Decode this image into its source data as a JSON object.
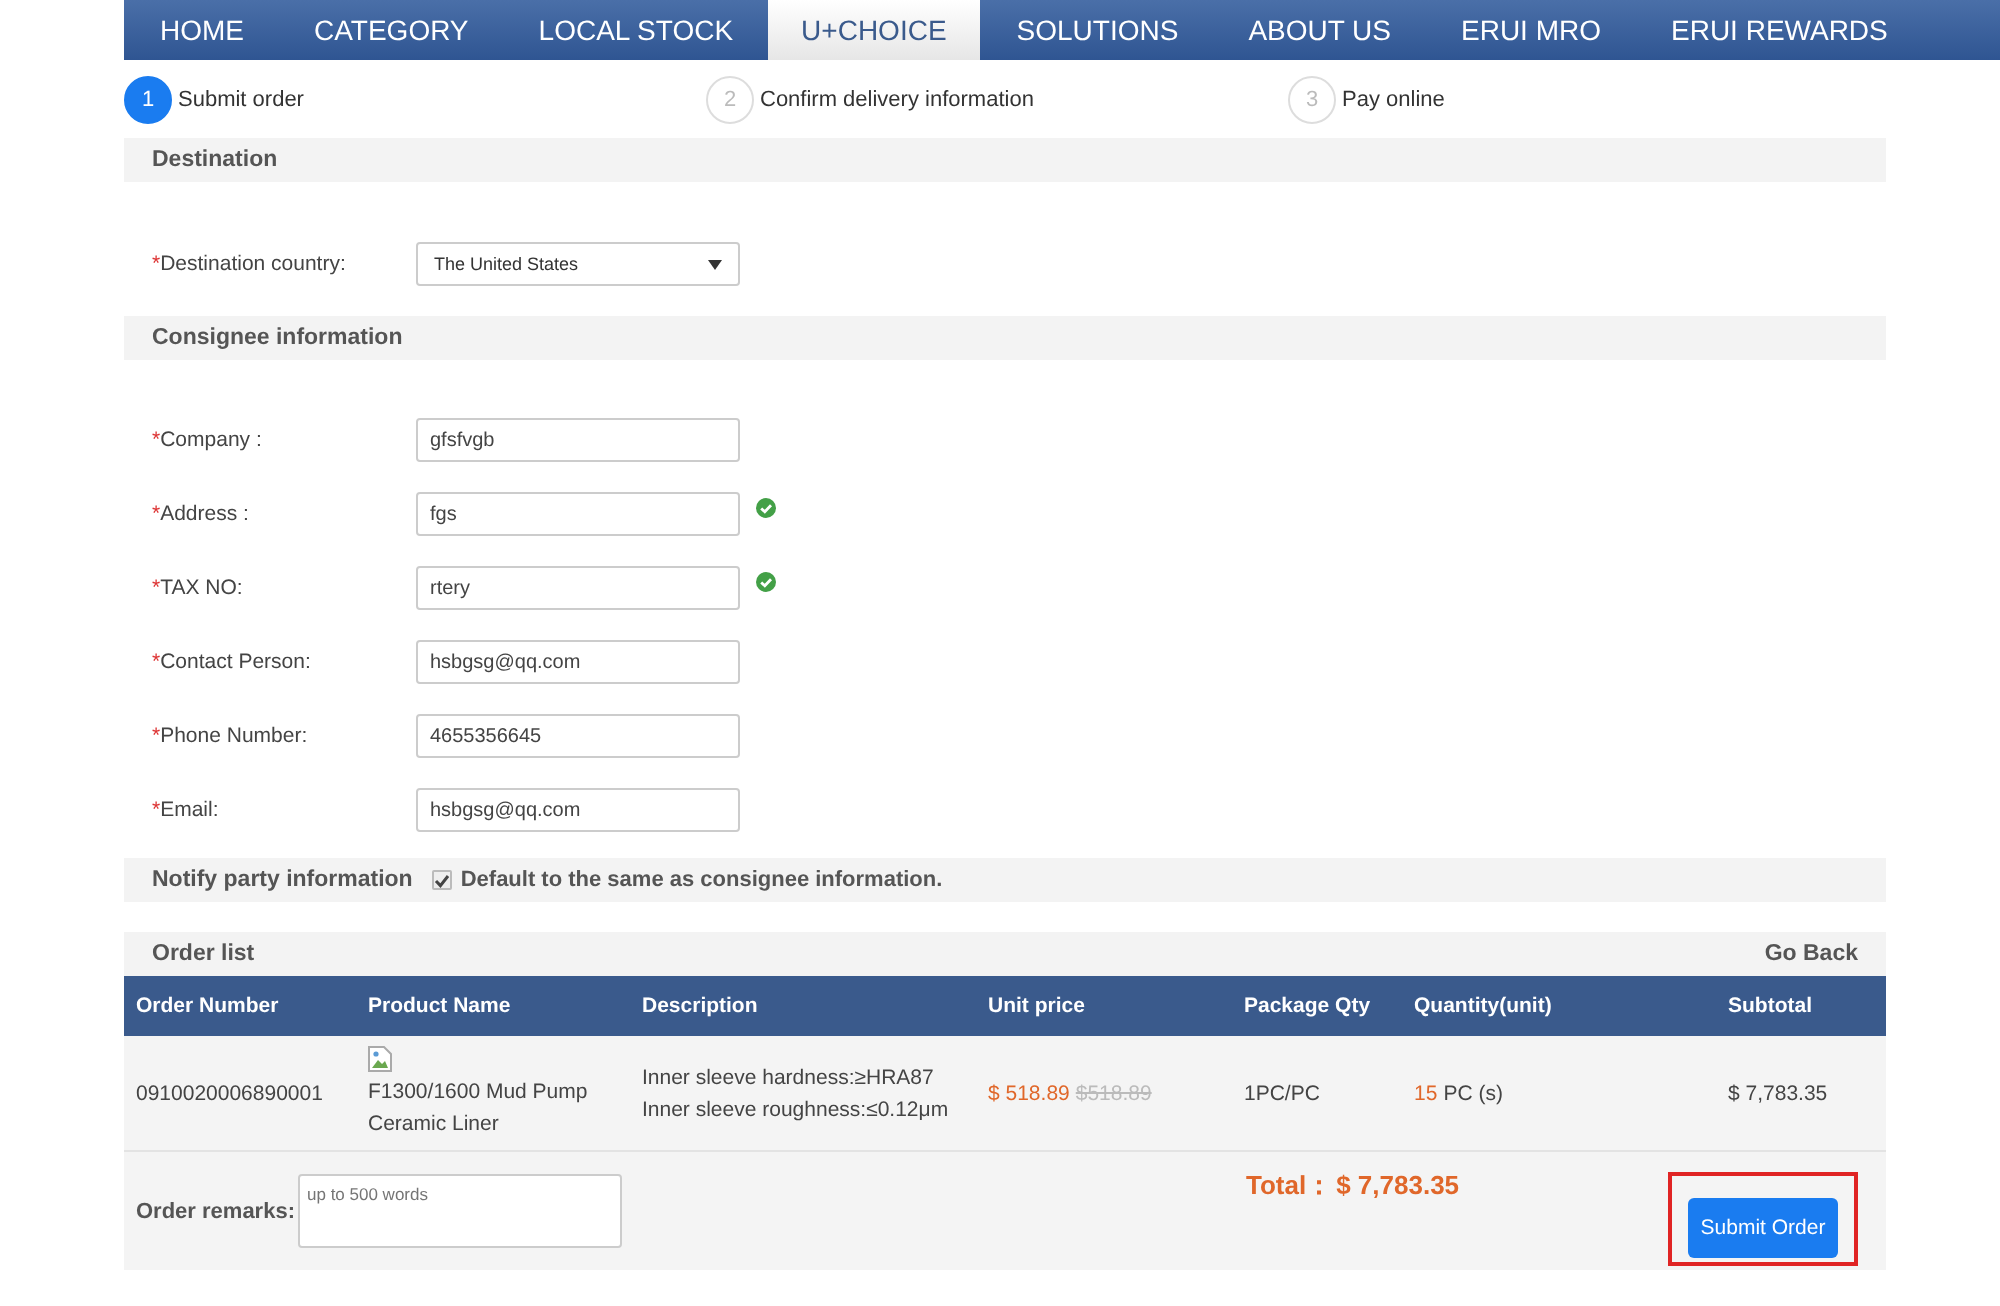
{
  "nav": [
    {
      "label": "HOME",
      "selected": false
    },
    {
      "label": "CATEGORY",
      "selected": false
    },
    {
      "label": "LOCAL STOCK",
      "selected": false
    },
    {
      "label": "U+CHOICE",
      "selected": true
    },
    {
      "label": "SOLUTIONS",
      "selected": false
    },
    {
      "label": "ABOUT US",
      "selected": false
    },
    {
      "label": "ERUI MRO",
      "selected": false
    },
    {
      "label": "ERUI REWARDS",
      "selected": false
    }
  ],
  "steps": [
    {
      "number": "1",
      "label": "Submit order",
      "active": true
    },
    {
      "number": "2",
      "label": "Confirm delivery information",
      "active": false
    },
    {
      "number": "3",
      "label": "Pay online",
      "active": false
    }
  ],
  "destination": {
    "title": "Destination",
    "fields": [
      {
        "kind": "select",
        "required_mark": "*",
        "label": "Destination country:",
        "value": "The United States"
      }
    ]
  },
  "consignee": {
    "title": "Consignee information",
    "fields": [
      {
        "kind": "text",
        "required_mark": "*",
        "label": "Company :",
        "value": "gfsfvgb",
        "valid": false
      },
      {
        "kind": "text",
        "required_mark": "*",
        "label": "Address :",
        "value": "fgs",
        "valid": true
      },
      {
        "kind": "text",
        "required_mark": "*",
        "label": "TAX NO:",
        "value": "rtery",
        "valid": true
      },
      {
        "kind": "text",
        "required_mark": "*",
        "label": "Contact Person:",
        "value": "hsbgsg@qq.com",
        "valid": false
      },
      {
        "kind": "text",
        "required_mark": "*",
        "label": "Phone Number:",
        "value": "4655356645",
        "valid": false
      },
      {
        "kind": "text",
        "required_mark": "*",
        "label": "Email:",
        "value": "hsbgsg@qq.com",
        "valid": false
      }
    ]
  },
  "notify": {
    "title": "Notify party information",
    "checkbox_label": "Default to the same as consignee information.",
    "checked": true
  },
  "order_list": {
    "title": "Order list",
    "go_back": "Go Back",
    "columns": [
      "Order Number",
      "Product Name",
      "Description",
      "Unit price",
      "Package Qty",
      "Quantity(unit)",
      "Subtotal"
    ],
    "rows": [
      {
        "order_number": "0910020006890001",
        "product_name": "F1300/1600 Mud Pump Ceramic Liner",
        "description": [
          "Inner sleeve hardness:≥HRA87",
          "Inner sleeve roughness:≤0.12μm"
        ],
        "unit_price": "$ 518.89",
        "original_price": "$518.89",
        "package_qty": "1PC/PC",
        "quantity": "15",
        "quantity_unit": "PC (s)",
        "subtotal": "$ 7,783.35"
      }
    ],
    "remarks_label": "Order remarks:",
    "remarks_placeholder": "up to 500 words",
    "total_label": "Total：",
    "total_value": "$ 7,783.35",
    "submit": {
      "label": "Submit Order",
      "highlighted": true
    }
  }
}
